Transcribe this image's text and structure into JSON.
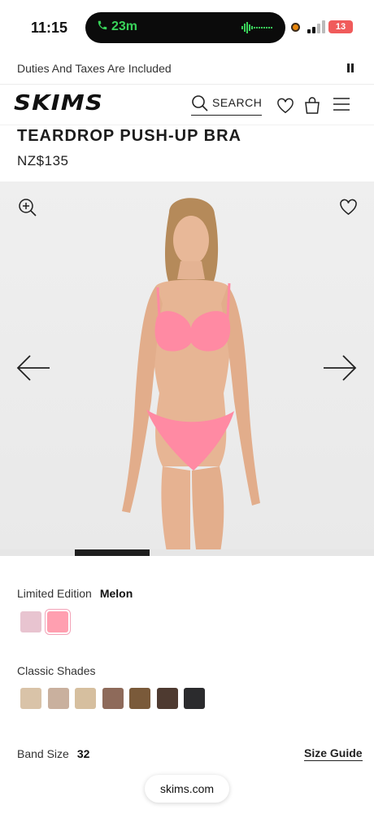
{
  "status_bar": {
    "time": "11:15",
    "call_duration": "23m",
    "battery": "13"
  },
  "banner": {
    "text": "Duties And Taxes Are Included"
  },
  "header": {
    "logo": "SKIMS",
    "search_label": "SEARCH"
  },
  "product": {
    "title": "TEARDROP PUSH-UP BRA",
    "price": "NZ$135"
  },
  "gallery": {
    "progress_fraction": 0.2,
    "progress_start_fraction": 0.2
  },
  "colors": {
    "edition_label": "Limited Edition",
    "selected_color": "Melon",
    "limited_swatches": [
      {
        "name": "pink-tie-dye",
        "hex": "#e8c4d0"
      },
      {
        "name": "melon",
        "hex": "#ff9fb0",
        "selected": true
      }
    ],
    "classic_label": "Classic Shades",
    "classic_swatches": [
      {
        "hex": "#d9c3a8"
      },
      {
        "hex": "#c9b09e"
      },
      {
        "hex": "#d6bf9f"
      },
      {
        "hex": "#8e6a5a"
      },
      {
        "hex": "#7a5a3a"
      },
      {
        "hex": "#4e3a30"
      },
      {
        "hex": "#2b2b2d"
      }
    ]
  },
  "size": {
    "label": "Band Size",
    "value": "32",
    "guide_label": "Size Guide"
  },
  "browser": {
    "url": "skims.com"
  }
}
